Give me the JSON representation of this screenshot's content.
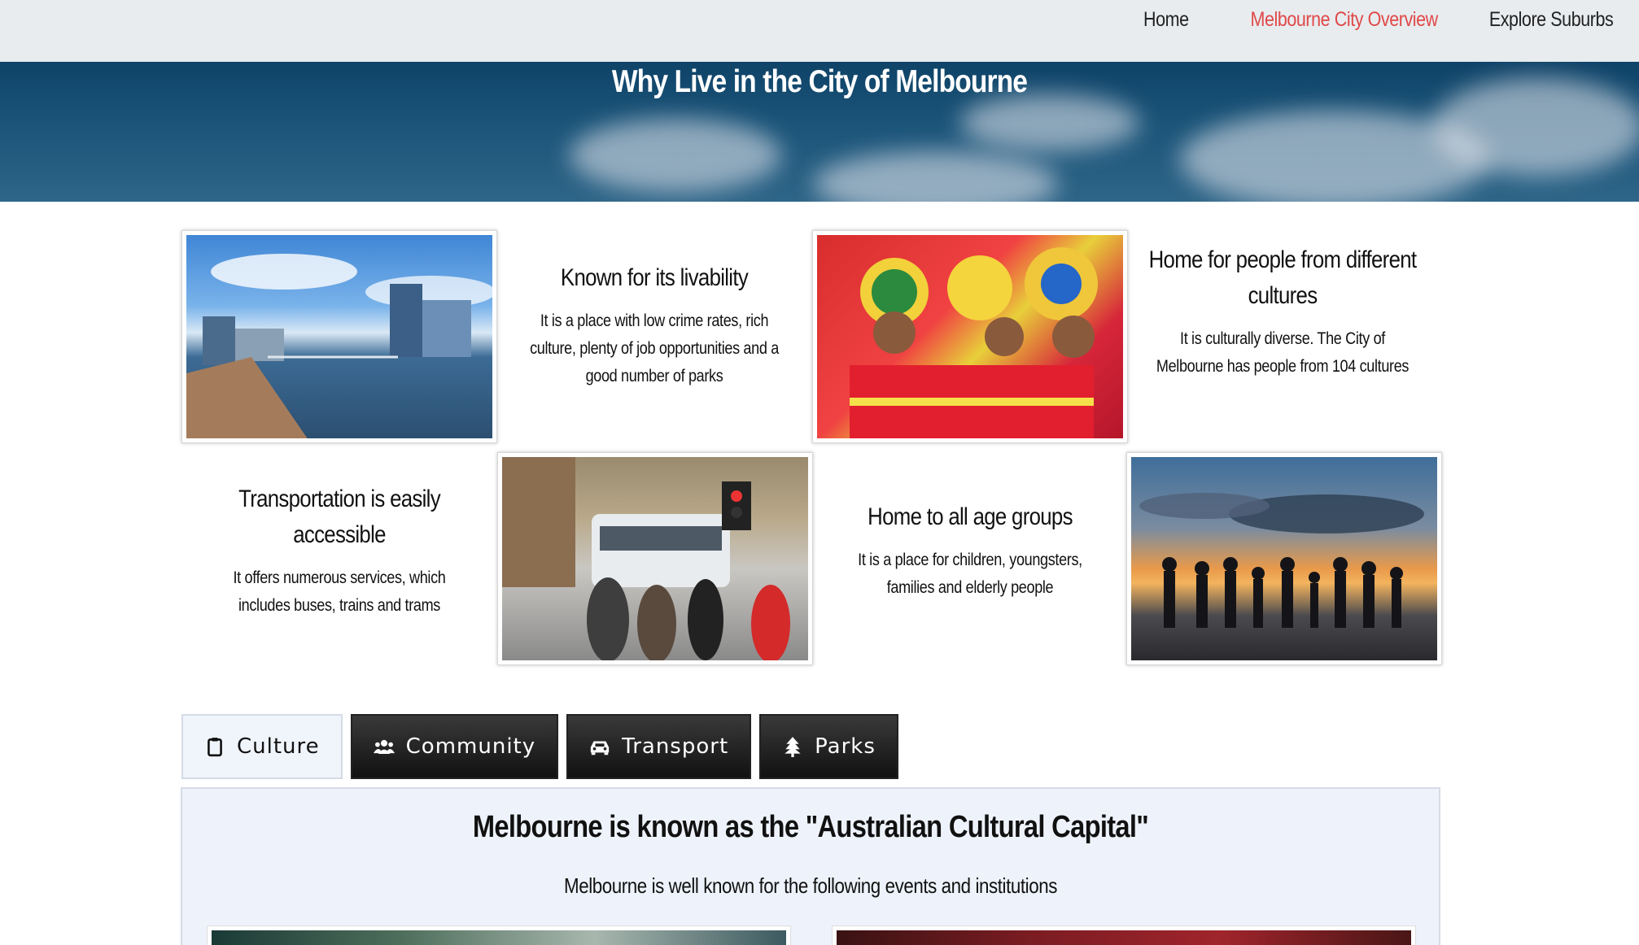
{
  "nav": {
    "items": [
      {
        "label": "Home",
        "active": false
      },
      {
        "label": "Melbourne City Overview",
        "active": true
      },
      {
        "label": "Explore Suburbs",
        "active": false
      }
    ],
    "active_color": "#e04848"
  },
  "hero": {
    "title": "Why Live in the City of Melbourne"
  },
  "features": [
    {
      "image": "river-city-waterfront",
      "title": "Known for its livability",
      "text": "It is a place with low crime rates, rich culture, plenty of job opportunities and a good number of parks"
    },
    {
      "image": "cultural-festival-dancers",
      "title": "Home for people from different cultures",
      "text": "It is culturally diverse. The City of Melbourne has people from 104 cultures"
    },
    {
      "image": "tram-street-crossing",
      "title": "Transportation is easily accessible",
      "text": "It offers numerous services, which includes buses, trains and trams"
    },
    {
      "image": "beach-sunset-family",
      "title": "Home to all age groups",
      "text": "It is a place for children, youngsters, families and elderly people"
    }
  ],
  "tabs": [
    {
      "label": "Culture",
      "icon": "clipboard-icon",
      "active": true
    },
    {
      "label": "Community",
      "icon": "users-icon",
      "active": false
    },
    {
      "label": "Transport",
      "icon": "car-icon",
      "active": false
    },
    {
      "label": "Parks",
      "icon": "tree-icon",
      "active": false
    }
  ],
  "panel": {
    "title": "Melbourne is known as the \"Australian Cultural Capital\"",
    "subtitle": "Melbourne is well known for the following events and institutions"
  }
}
